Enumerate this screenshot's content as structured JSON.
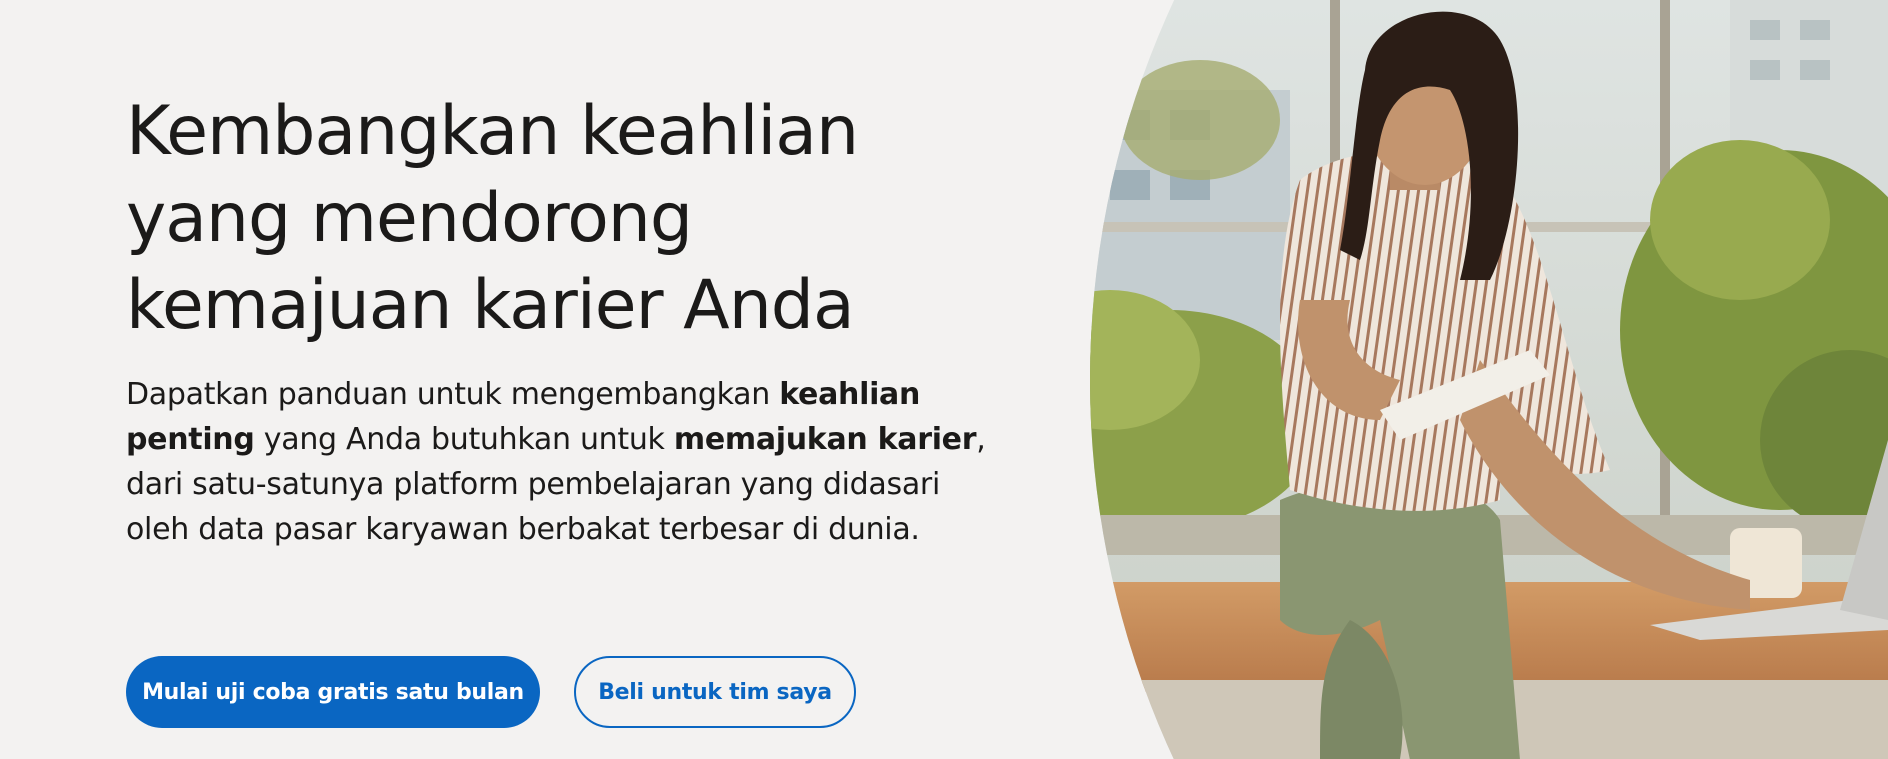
{
  "hero": {
    "headline_line1": "Kembangkan keahlian",
    "headline_line2": "yang mendorong",
    "headline_line3": "kemajuan karier Anda",
    "description": {
      "part1": "Dapatkan panduan untuk mengembangkan ",
      "bold1": "keahlian penting",
      "part2": " yang Anda butuhkan untuk ",
      "bold2": "memajukan karier",
      "part3": ", dari satu-satunya platform pembelajaran yang didasari oleh data pasar karyawan berbakat terbesar di dunia."
    },
    "primary_button": "Mulai uji coba gratis satu bulan",
    "secondary_button": "Beli untuk tim saya"
  },
  "colors": {
    "background": "#f3f2f1",
    "accent": "#0a66c2",
    "text": "#1b1a19"
  },
  "photo": {
    "alt_subject": "woman-writing-notebook-with-laptop"
  }
}
